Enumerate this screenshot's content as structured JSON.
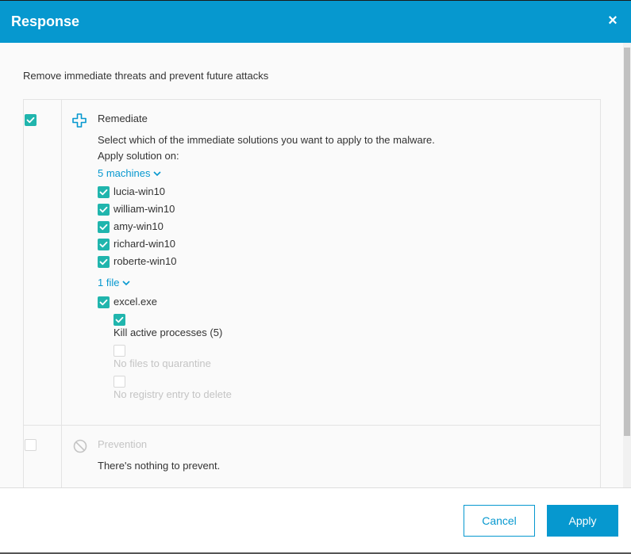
{
  "dialog": {
    "title": "Response",
    "close_symbol": "×"
  },
  "intro": "Remove immediate threats and prevent future attacks",
  "remediate": {
    "label": "Remediate",
    "checked": true,
    "description": "Select which of the immediate solutions you want to apply to the malware.",
    "apply_on_label": "Apply solution on:",
    "machines_toggle": "5 machines",
    "machines": [
      {
        "name": "lucia-win10",
        "checked": true
      },
      {
        "name": "william-win10",
        "checked": true
      },
      {
        "name": "amy-win10",
        "checked": true
      },
      {
        "name": "richard-win10",
        "checked": true
      },
      {
        "name": "roberte-win10",
        "checked": true
      }
    ],
    "files_toggle": "1 file",
    "files": [
      {
        "name": "excel.exe",
        "checked": true,
        "actions": [
          {
            "label": "Kill active processes (5)",
            "checked": true,
            "disabled": false
          },
          {
            "label": "No files to quarantine",
            "checked": false,
            "disabled": true
          },
          {
            "label": "No registry entry to delete",
            "checked": false,
            "disabled": true
          }
        ]
      }
    ]
  },
  "prevention": {
    "label": "Prevention",
    "checked": false,
    "description": "There's nothing to prevent."
  },
  "footer": {
    "cancel_label": "Cancel",
    "apply_label": "Apply"
  },
  "colors": {
    "accent": "#0698cf",
    "check": "#20b5ad",
    "muted": "#c4c4c4"
  }
}
